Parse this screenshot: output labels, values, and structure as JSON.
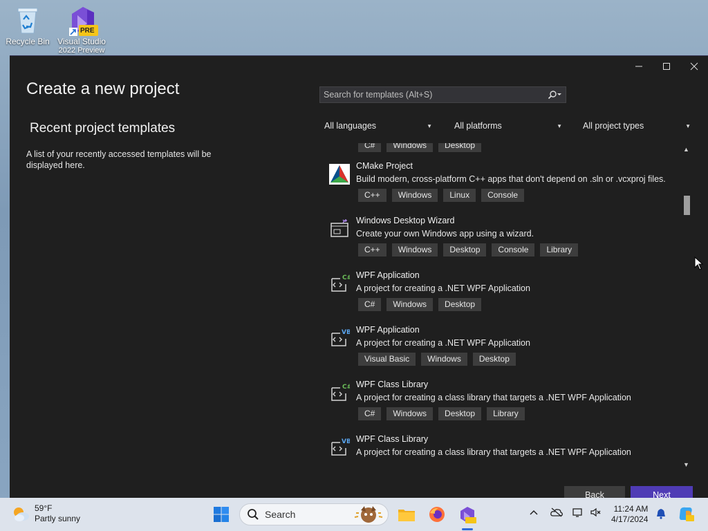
{
  "desktop": {
    "recycle_bin_label": "Recycle Bin",
    "vs_label": "Visual Studio",
    "vs_label_2": "2022 Preview",
    "vs_badge": "PRE"
  },
  "window": {
    "title": "Create a new project",
    "recent_title": "Recent project templates",
    "recent_desc": "A list of your recently accessed templates will be displayed here.",
    "search_placeholder": "Search for templates (Alt+S)",
    "filters": {
      "languages": "All languages",
      "platforms": "All platforms",
      "project_types": "All project types"
    },
    "partial_tags": [
      "C#",
      "Windows",
      "Desktop"
    ],
    "templates": [
      {
        "name": "CMake Project",
        "desc": "Build modern, cross-platform C++ apps that don't depend on .sln or .vcxproj files.",
        "tags": [
          "C++",
          "Windows",
          "Linux",
          "Console"
        ],
        "icon": "cmake-icon"
      },
      {
        "name": "Windows Desktop Wizard",
        "desc": "Create your own Windows app using a wizard.",
        "tags": [
          "C++",
          "Windows",
          "Desktop",
          "Console",
          "Library"
        ],
        "icon": "desktop-wizard-icon"
      },
      {
        "name": "WPF Application",
        "desc": "A project for creating a .NET WPF Application",
        "tags": [
          "C#",
          "Windows",
          "Desktop"
        ],
        "icon": "wpf-csharp-icon",
        "badge": "C#"
      },
      {
        "name": "WPF Application",
        "desc": "A project for creating a .NET WPF Application",
        "tags": [
          "Visual Basic",
          "Windows",
          "Desktop"
        ],
        "icon": "wpf-vb-icon",
        "badge": "VB"
      },
      {
        "name": "WPF Class Library",
        "desc": "A project for creating a class library that targets a .NET WPF Application",
        "tags": [
          "C#",
          "Windows",
          "Desktop",
          "Library"
        ],
        "icon": "wpf-csharp-icon",
        "badge": "C#"
      },
      {
        "name": "WPF Class Library",
        "desc": "A project for creating a class library that targets a .NET WPF Application",
        "tags": [],
        "icon": "wpf-vb-icon",
        "badge": "VB"
      }
    ],
    "back_label": "Back",
    "next_label": "Next"
  },
  "taskbar": {
    "weather_temp": "59°F",
    "weather_desc": "Partly sunny",
    "search_label": "Search",
    "time": "11:24 AM",
    "date": "4/17/2024"
  },
  "colors": {
    "window_bg": "#1f1f1f",
    "accent": "#4f3bb5",
    "tag_bg": "#3d3d3d"
  }
}
